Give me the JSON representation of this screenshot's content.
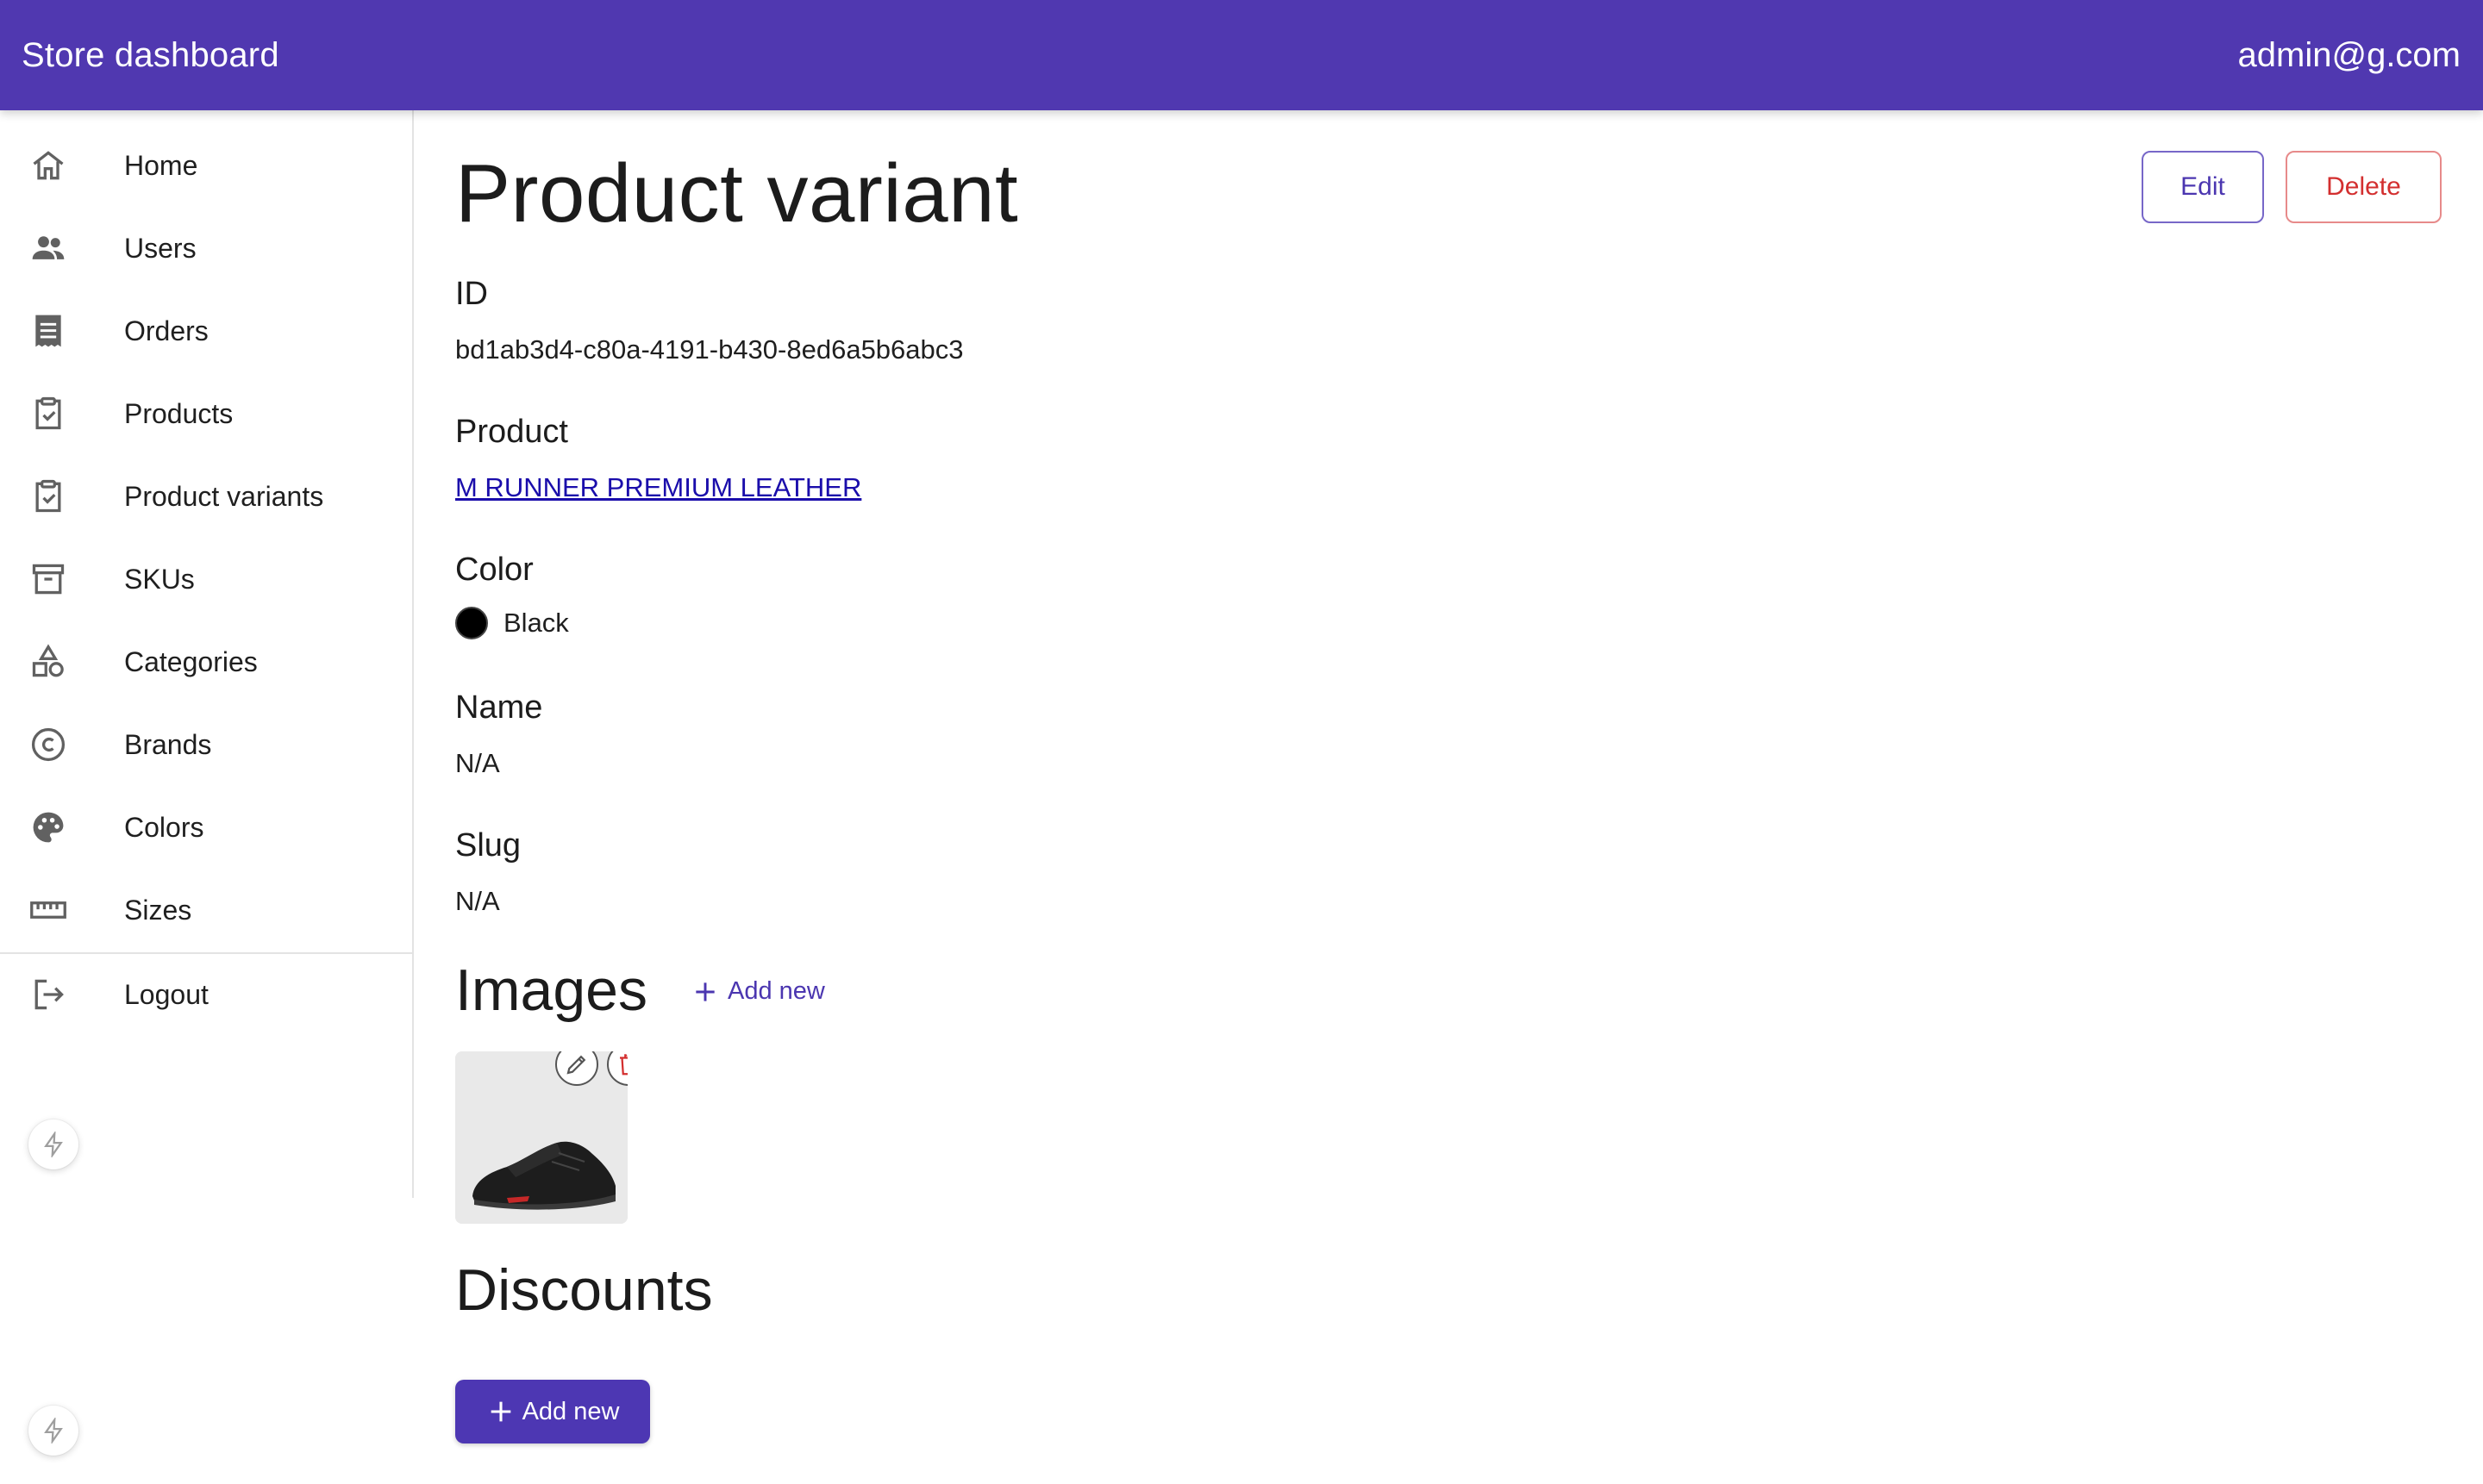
{
  "header": {
    "title": "Store dashboard",
    "user": "admin@g.com"
  },
  "sidebar": {
    "items": [
      {
        "label": "Home",
        "icon": "home-icon"
      },
      {
        "label": "Users",
        "icon": "users-icon"
      },
      {
        "label": "Orders",
        "icon": "receipt-icon"
      },
      {
        "label": "Products",
        "icon": "clipboard-check-icon"
      },
      {
        "label": "Product variants",
        "icon": "clipboard-check-icon"
      },
      {
        "label": "SKUs",
        "icon": "archive-icon"
      },
      {
        "label": "Categories",
        "icon": "shapes-icon"
      },
      {
        "label": "Brands",
        "icon": "copyright-icon"
      },
      {
        "label": "Colors",
        "icon": "palette-icon"
      },
      {
        "label": "Sizes",
        "icon": "ruler-icon"
      }
    ],
    "logout": {
      "label": "Logout",
      "icon": "logout-icon"
    }
  },
  "page": {
    "title": "Product variant",
    "edit_label": "Edit",
    "delete_label": "Delete"
  },
  "fields": {
    "id": {
      "label": "ID",
      "value": "bd1ab3d4-c80a-4191-b430-8ed6a5b6abc3"
    },
    "product": {
      "label": "Product",
      "value": "M RUNNER PREMIUM LEATHER"
    },
    "color": {
      "label": "Color",
      "value": "Black",
      "swatch": "#000000"
    },
    "name": {
      "label": "Name",
      "value": "N/A"
    },
    "slug": {
      "label": "Slug",
      "value": "N/A"
    }
  },
  "images": {
    "title": "Images",
    "add_label": "Add new",
    "count": 1
  },
  "discounts": {
    "title": "Discounts",
    "add_label": "Add new"
  },
  "colors": {
    "accent": "#5038b0",
    "danger": "#d32f2f",
    "link": "#1a0dab"
  }
}
